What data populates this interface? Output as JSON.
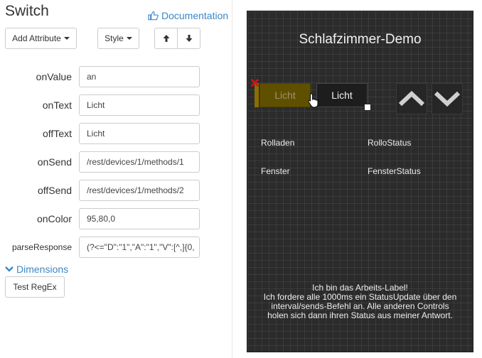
{
  "editor": {
    "title": "Switch",
    "documentation_label": "Documentation",
    "toolbar": {
      "add_attribute_label": "Add Attribute",
      "style_label": "Style"
    },
    "attributes": [
      {
        "name": "onValue",
        "value": "an"
      },
      {
        "name": "onText",
        "value": "Licht"
      },
      {
        "name": "offText",
        "value": "Licht"
      },
      {
        "name": "onSend",
        "value": "/rest/devices/1/methods/1"
      },
      {
        "name": "offSend",
        "value": "/rest/devices/1/methods/2"
      },
      {
        "name": "onColor",
        "value": "95,80,0"
      },
      {
        "name": "parseResponse",
        "value": "(?<=\"D\":\"1\",\"A\":\"1\",\"V\":[^,]{0,"
      }
    ],
    "dimensions_label": "Dimensions",
    "test_regex_label": "Test RegEx"
  },
  "preview": {
    "title": "Schlafzimmer-Demo",
    "switch_off_text": "Licht",
    "switch_on_text": "Licht",
    "labels": {
      "rolladen": "Rolladen",
      "rollo_status": "RolloStatus",
      "fenster": "Fenster",
      "fenster_status": "FensterStatus"
    },
    "info_lines": [
      "Ich bin das Arbeits-Label!",
      "Ich fordere alle 1000ms ein StatusUpdate über den",
      "interval/sends-Befehl an. Alle anderen Controls",
      "holen sich dann ihren Status aus meiner Antwort."
    ]
  },
  "colors": {
    "link": "#3a87c8",
    "preview_bg": "#2b2b2b",
    "switch_on_color": "#5f5000"
  },
  "icons": [
    "thumbs-up-icon",
    "caret-down-icon",
    "arrow-up-icon",
    "arrow-down-icon",
    "chevron-down-icon",
    "chevron-up-icon",
    "close-icon",
    "hand-cursor-icon"
  ]
}
